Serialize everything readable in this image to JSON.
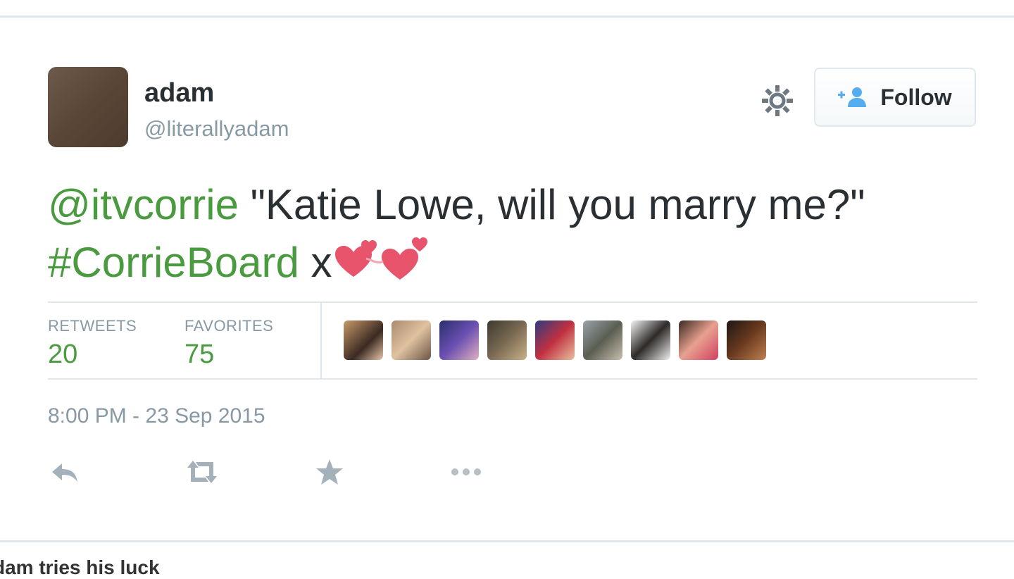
{
  "tweet": {
    "display_name": "adam",
    "handle": "@literallyadam",
    "follow_label": "Follow",
    "text": {
      "mention": "@itvcorrie",
      "body": " \"Katie Lowe, will you marry me?\" ",
      "hashtag": "#CorrieBoard",
      "suffix": " x"
    },
    "stats": {
      "retweets_label": "RETWEETS",
      "retweets_value": "20",
      "favorites_label": "FAVORITES",
      "favorites_value": "75"
    },
    "timestamp": "8:00 PM - 23 Sep 2015"
  },
  "caption": "dam tries his luck",
  "colors": {
    "link_green": "#4a9a3f",
    "muted_gray": "#8899a6",
    "text_dark": "#292f33",
    "heart_pink": "#e8546b"
  },
  "icons": {
    "settings": "gear-icon",
    "follow": "add-person-icon",
    "reply": "reply-icon",
    "retweet": "retweet-icon",
    "favorite": "star-icon",
    "more": "more-icon",
    "emoji": "two-hearts-icon"
  }
}
